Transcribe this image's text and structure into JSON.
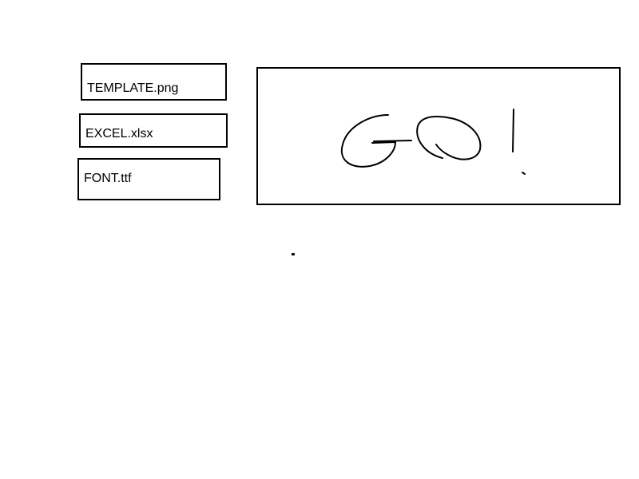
{
  "files": [
    {
      "label": "TEMPLATE.png"
    },
    {
      "label": "EXCEL.xlsx"
    },
    {
      "label": "FONT.ttf"
    }
  ],
  "go_button": {
    "text": "GO!",
    "style": "handwritten"
  },
  "colors": {
    "background": "#ffffff",
    "ink": "#000000"
  }
}
